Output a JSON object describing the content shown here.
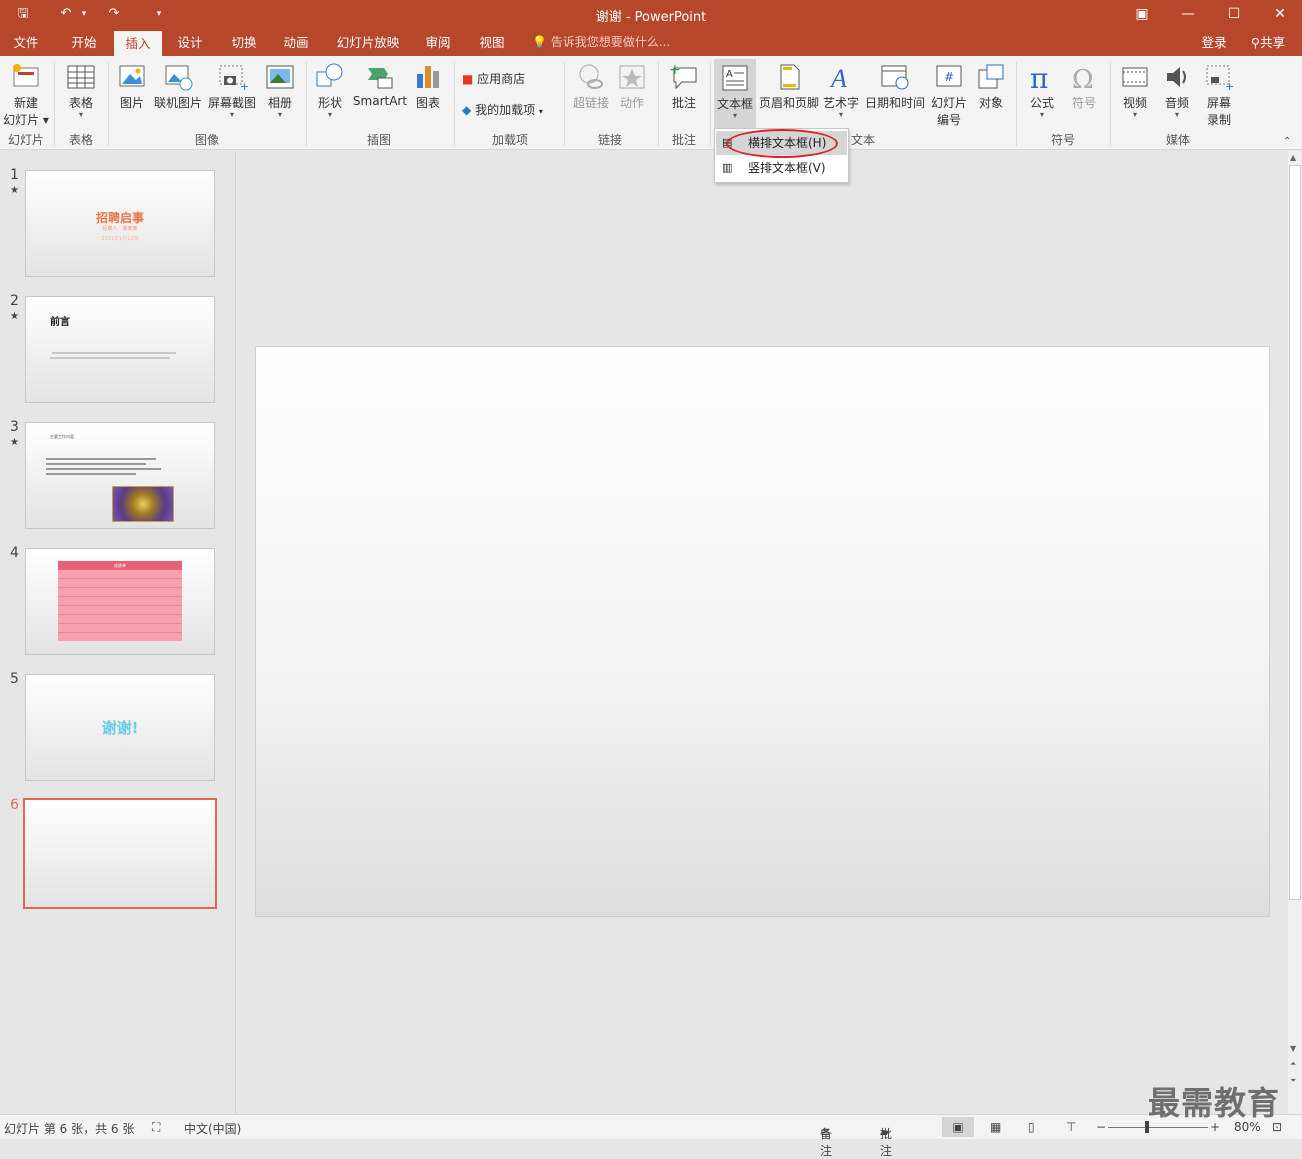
{
  "titlebar": {
    "title": "谢谢 - PowerPoint",
    "save": "🖫",
    "undo": "↶",
    "undo_caret": "▾",
    "redo": "↷",
    "customize": "▾",
    "ribbon_opts": "▣",
    "minimize": "—",
    "maximize": "☐",
    "close": "✕"
  },
  "tabs": [
    "文件",
    "开始",
    "插入",
    "设计",
    "切换",
    "动画",
    "幻灯片放映",
    "审阅",
    "视图"
  ],
  "tell_me": "告诉我您想要做什么...",
  "account": {
    "login": "登录",
    "share": "共享"
  },
  "ribbon": {
    "new_slide": "新建",
    "new_slide2": "幻灯片",
    "table": "表格",
    "picture": "图片",
    "online_picture": "联机图片",
    "screenshot": "屏幕截图",
    "album": "相册",
    "shapes": "形状",
    "smartart": "SmartArt",
    "chart": "图表",
    "store": "应用商店",
    "my_addins": "我的加载项",
    "hyperlink": "超链接",
    "action": "动作",
    "comment": "批注",
    "textbox": "文本框",
    "header_footer": "页眉和页脚",
    "wordart": "艺术字",
    "datetime": "日期和时间",
    "slide_num": "幻灯片",
    "slide_num2": "编号",
    "object": "对象",
    "equation": "公式",
    "symbol": "符号",
    "video": "视频",
    "audio": "音频",
    "screen_rec": "屏幕",
    "screen_rec2": "录制",
    "groups": {
      "slides": "幻灯片",
      "tables": "表格",
      "images": "图像",
      "illustrations": "插图",
      "addins": "加载项",
      "links": "链接",
      "comments": "批注",
      "text": "文本",
      "symbols": "符号",
      "media": "媒体"
    }
  },
  "dropdown": {
    "horizontal": "横排文本框(H)",
    "vertical": "竖排文本框(V)"
  },
  "thumbnails": [
    {
      "num": "1",
      "star": "★",
      "title": "招聘启事",
      "sub": "招聘人：某某某",
      "date": "2021年1月12日"
    },
    {
      "num": "2",
      "star": "★",
      "title": "前言"
    },
    {
      "num": "3",
      "star": "★",
      "heading": "主要工作内容"
    },
    {
      "num": "4",
      "title": "成绩单"
    },
    {
      "num": "5",
      "title": "谢谢!"
    },
    {
      "num": "6"
    }
  ],
  "status": {
    "slide_info": "幻灯片 第 6 张，共 6 张",
    "lang": "中文(中国)",
    "notes": "备注",
    "comments": "批注",
    "zoom_minus": "−",
    "zoom_plus": "+",
    "zoom": "80%"
  },
  "watermark": "最需教育",
  "colors": {
    "accent": "#b7472a",
    "selection": "#e06a4d",
    "highlight_oval": "#e0211d"
  }
}
